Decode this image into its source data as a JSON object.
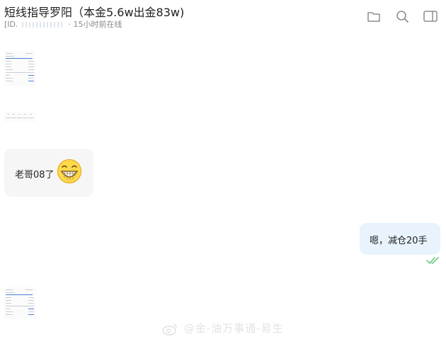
{
  "header": {
    "title": "短线指导罗阳（本金5.6w出金83w)",
    "id_prefix": "[ID. ",
    "id_suffix": " · 15小时前在线"
  },
  "icons": {
    "folder": "folder-icon",
    "search": "search-icon",
    "sidebar": "sidebar-toggle-icon",
    "read": "double-check-icon",
    "emoji": "grinning-face-emoji",
    "watermark": "weibo-logo-icon"
  },
  "messages": [
    {
      "side": "left",
      "type": "image",
      "time": ""
    },
    {
      "side": "left",
      "type": "image",
      "time": ""
    },
    {
      "side": "left",
      "type": "text",
      "text": "老哥08了"
    },
    {
      "side": "right",
      "type": "text",
      "text": "嗯，减仓20手"
    },
    {
      "side": "left",
      "type": "image",
      "time": ""
    }
  ],
  "watermark": {
    "text": "@金-油万事通-易生"
  },
  "colors": {
    "right_bubble": "#e8f3fd",
    "left_bubble": "#f6f6f6",
    "read_check": "#5cc47a"
  }
}
